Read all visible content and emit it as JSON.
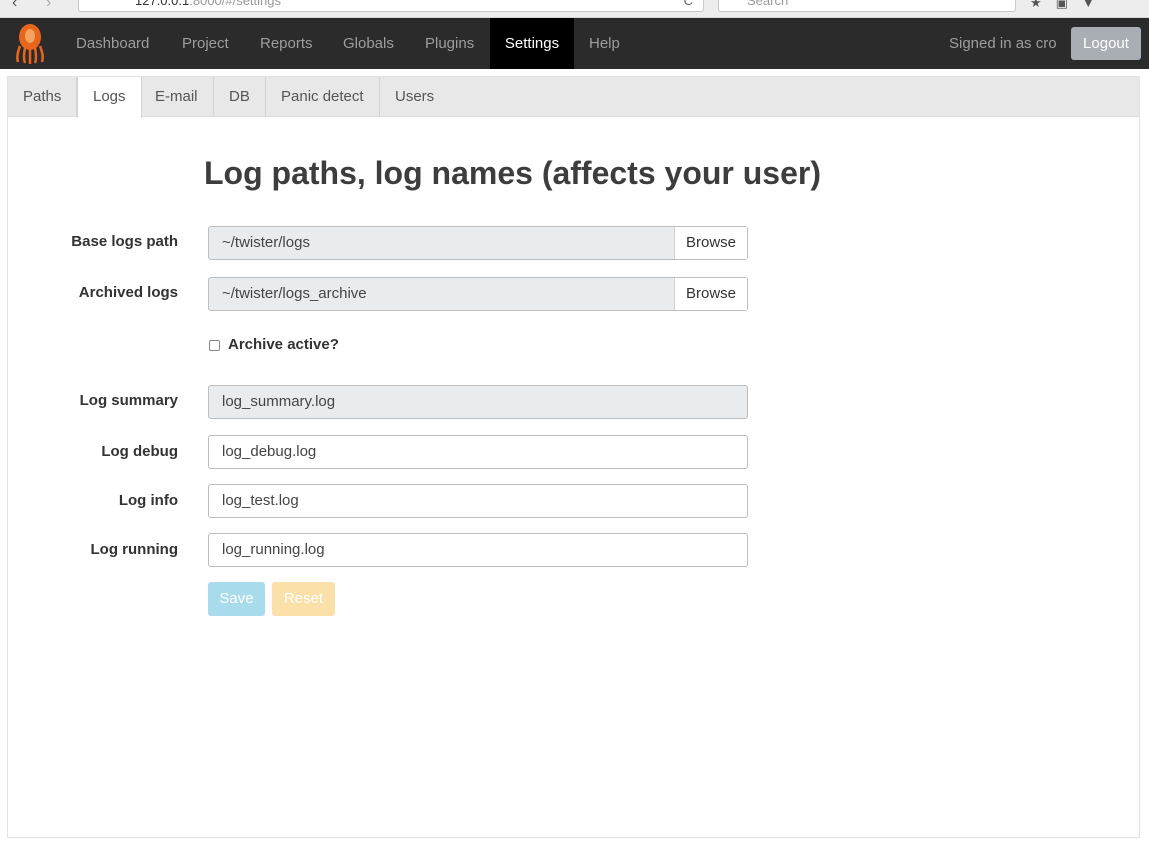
{
  "browser": {
    "url_host": "127.0.0.1",
    "url_rest": ":8000/#/settings",
    "search_placeholder": "Search",
    "reload_glyph": "C"
  },
  "navbar": {
    "brand_icon": "octopus-logo",
    "items": [
      {
        "label": "Dashboard"
      },
      {
        "label": "Project"
      },
      {
        "label": "Reports"
      },
      {
        "label": "Globals"
      },
      {
        "label": "Plugins"
      },
      {
        "label": "Settings",
        "active": true
      },
      {
        "label": "Help"
      }
    ],
    "signed_in_text": "Signed in as cro",
    "logout_label": "Logout",
    "colors": {
      "bg": "#2b2b2b",
      "active_bg": "#000000",
      "logo": "#e8661c"
    }
  },
  "tabs": [
    {
      "label": "Paths"
    },
    {
      "label": "Logs",
      "active": true
    },
    {
      "label": "E-mail"
    },
    {
      "label": "DB"
    },
    {
      "label": "Panic detect"
    },
    {
      "label": "Users"
    }
  ],
  "form": {
    "title": "Log paths, log names (affects your user)",
    "base_logs_path": {
      "label": "Base logs path",
      "value": "~/twister/logs",
      "browse_label": "Browse"
    },
    "archived_logs": {
      "label": "Archived logs",
      "value": "~/twister/logs_archive",
      "browse_label": "Browse"
    },
    "archive_active": {
      "label": "Archive active?",
      "checked": false
    },
    "log_summary": {
      "label": "Log summary",
      "value": "log_summary.log"
    },
    "log_debug": {
      "label": "Log debug",
      "value": "log_debug.log"
    },
    "log_info": {
      "label": "Log info",
      "value": "log_test.log"
    },
    "log_running": {
      "label": "Log running",
      "value": "log_running.log"
    },
    "save_label": "Save",
    "reset_label": "Reset"
  }
}
